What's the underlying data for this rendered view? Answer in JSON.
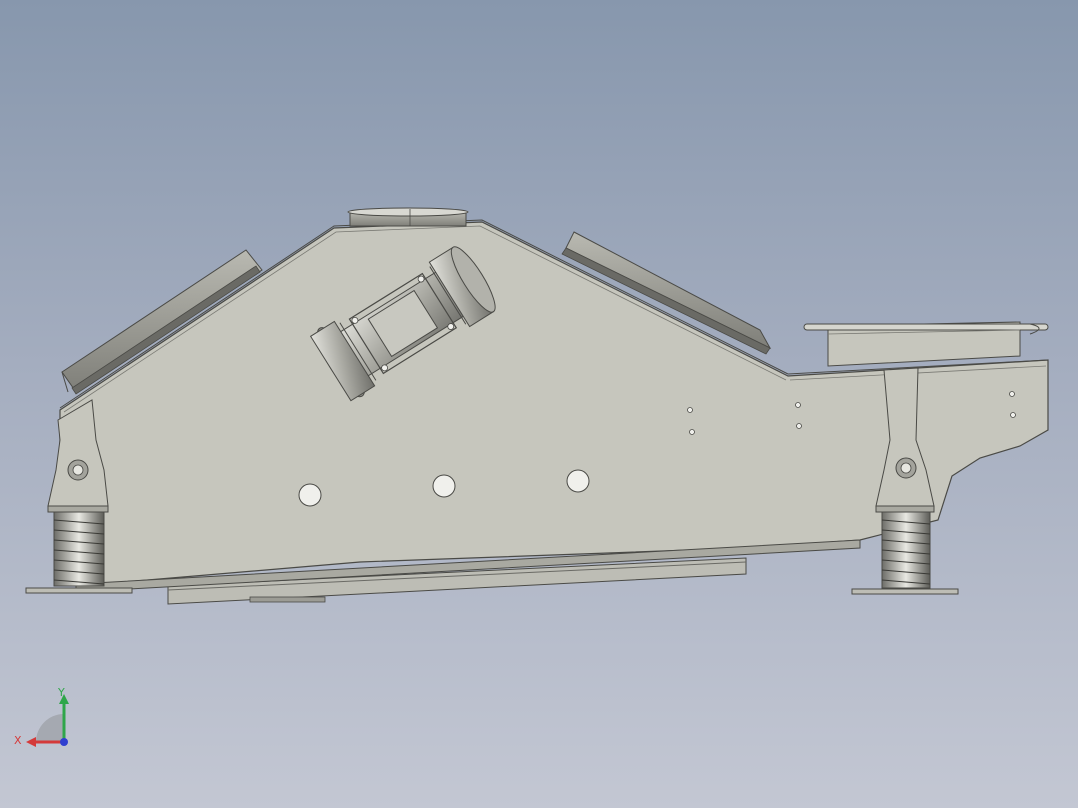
{
  "viewport": {
    "background_top": "#8797ad",
    "background_bottom": "#c3c7d3"
  },
  "model": {
    "body_color": "#c6c6bd",
    "shadow_color": "#8d8d86",
    "edge_color": "#4a4a46",
    "hole_color": "#f0f0ec"
  },
  "triad": {
    "x_label": "X",
    "y_label": "Y",
    "x_color": "#d43a3a",
    "y_color": "#2fa64a",
    "z_color": "#2f3fd0"
  }
}
